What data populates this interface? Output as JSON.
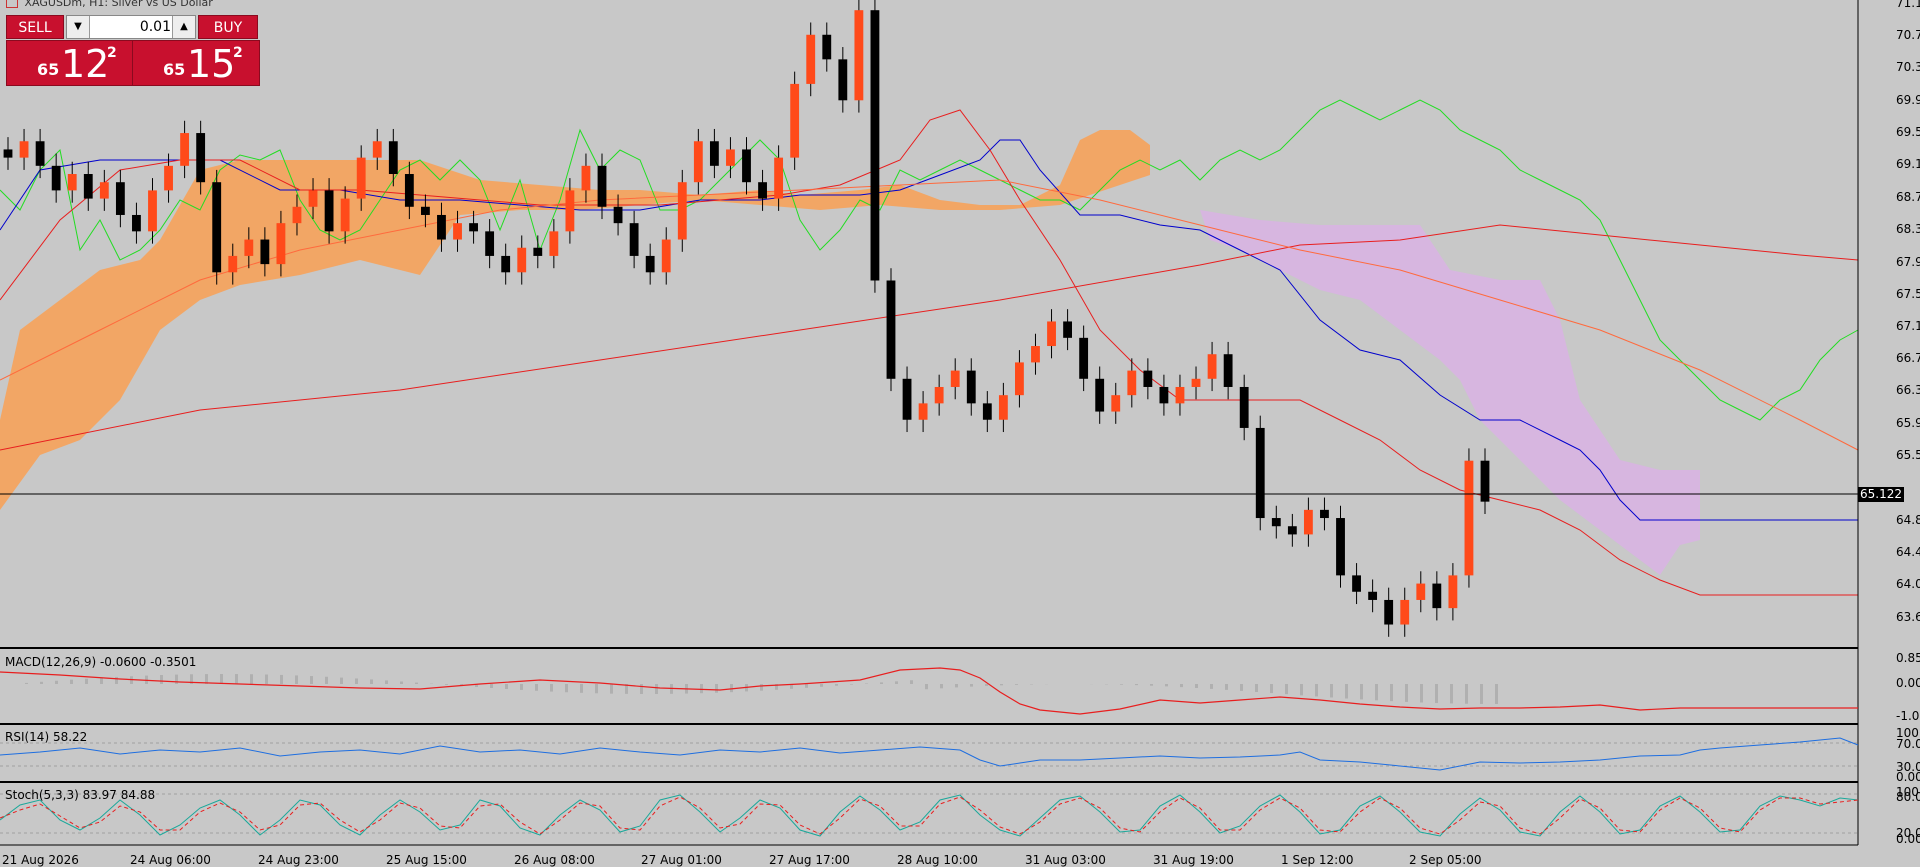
{
  "window": {
    "title": "XAGUSDm, H1:  Silver vs US Dollar"
  },
  "trade_panel": {
    "sell_label": "SELL",
    "buy_label": "BUY",
    "lot_value": "0.01",
    "sell_price": {
      "small": "65",
      "big": "12",
      "sup": "2"
    },
    "buy_price": {
      "small": "65",
      "big": "15",
      "sup": "2"
    }
  },
  "main_chart": {
    "current_price_label": "65.122",
    "price_axis": [
      "71.125",
      "70.725",
      "70.330",
      "69.935",
      "69.540",
      "69.145",
      "68.750",
      "68.355",
      "67.960",
      "67.565",
      "67.170",
      "66.775",
      "66.380",
      "65.985",
      "65.590",
      "64.800",
      "64.405",
      "64.010",
      "63.615"
    ],
    "price_range": [
      63.35,
      71.2
    ]
  },
  "indicators": {
    "macd": {
      "label": "MACD(12,26,9) -0.0600 -0.3501",
      "axis": [
        "0.8520",
        "0.0000",
        "-1.0133"
      ]
    },
    "rsi": {
      "label": "RSI(14) 58.22",
      "axis": [
        "100.00",
        "70.00",
        "30.00",
        "0.00"
      ]
    },
    "stoch": {
      "label": "Stoch(5,3,3) 83.97 84.88",
      "axis": [
        "100.00",
        "80.00",
        "20.00",
        "0.00"
      ]
    }
  },
  "time_axis": [
    "21 Aug 2026",
    "24 Aug 06:00",
    "24 Aug 23:00",
    "25 Aug 15:00",
    "26 Aug 08:00",
    "27 Aug 01:00",
    "27 Aug 17:00",
    "28 Aug 10:00",
    "31 Aug 03:00",
    "31 Aug 19:00",
    "1 Sep 12:00",
    "2 Sep 05:00"
  ],
  "colors": {
    "background": "#c8c8c8",
    "bull_candle": "#ff4a1a",
    "bear_candle": "#000000",
    "kumo_bull": "#f4a460",
    "kumo_bear": "#d8b4e2",
    "tenkan": "#0000cc",
    "kijun": "#e81e1e",
    "chikou": "#22dd22",
    "sell_buy": "#c8102e"
  },
  "chart_data": {
    "type": "candlestick",
    "symbol": "XAGUSDm",
    "timeframe": "H1",
    "close_series": [
      69.3,
      69.5,
      69.2,
      68.9,
      69.1,
      68.8,
      69.0,
      68.6,
      68.4,
      68.9,
      69.2,
      69.6,
      69.0,
      67.9,
      68.1,
      68.3,
      68.0,
      68.5,
      68.7,
      68.9,
      68.4,
      68.8,
      69.3,
      69.5,
      69.1,
      68.7,
      68.6,
      68.3,
      68.5,
      68.4,
      68.1,
      67.9,
      68.2,
      68.1,
      68.4,
      68.9,
      69.2,
      68.7,
      68.5,
      68.1,
      67.9,
      68.3,
      69.0,
      69.5,
      69.2,
      69.4,
      69.0,
      68.8,
      69.3,
      70.2,
      70.8,
      70.5,
      70.0,
      71.1,
      67.8,
      66.6,
      66.1,
      66.3,
      66.5,
      66.7,
      66.3,
      66.1,
      66.4,
      66.8,
      67.0,
      67.3,
      67.1,
      66.6,
      66.2,
      66.4,
      66.7,
      66.5,
      66.3,
      66.5,
      66.6,
      66.9,
      66.5,
      66.0,
      64.9,
      64.8,
      64.7,
      65.0,
      64.9,
      64.2,
      64.0,
      63.9,
      63.6,
      63.9,
      64.1,
      63.8,
      64.2,
      65.6,
      65.1
    ],
    "open_series": [
      69.4,
      69.3,
      69.5,
      69.2,
      68.9,
      69.1,
      68.8,
      69.0,
      68.6,
      68.4,
      68.9,
      69.2,
      69.6,
      69.0,
      67.9,
      68.1,
      68.3,
      68.0,
      68.5,
      68.7,
      68.9,
      68.4,
      68.8,
      69.3,
      69.5,
      69.1,
      68.7,
      68.6,
      68.3,
      68.5,
      68.4,
      68.1,
      67.9,
      68.2,
      68.1,
      68.4,
      68.9,
      69.2,
      68.7,
      68.5,
      68.1,
      67.9,
      68.3,
      69.0,
      69.5,
      69.2,
      69.4,
      69.0,
      68.8,
      69.3,
      70.2,
      70.8,
      70.5,
      70.0,
      71.1,
      67.8,
      66.6,
      66.1,
      66.3,
      66.5,
      66.7,
      66.3,
      66.1,
      66.4,
      66.8,
      67.0,
      67.3,
      67.1,
      66.6,
      66.2,
      66.4,
      66.7,
      66.5,
      66.3,
      66.5,
      66.6,
      66.9,
      66.5,
      66.0,
      64.9,
      64.8,
      64.7,
      65.0,
      64.9,
      64.2,
      64.0,
      63.9,
      63.6,
      63.9,
      64.1,
      63.8,
      64.2,
      65.6
    ]
  }
}
